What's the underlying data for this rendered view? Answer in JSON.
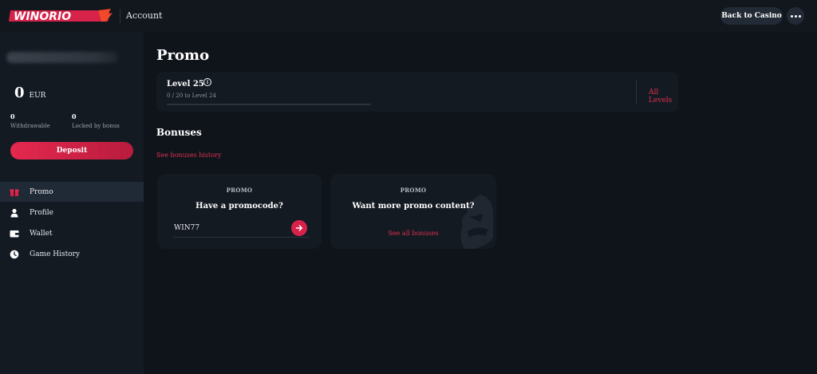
{
  "header": {
    "logo_text": "WINORIO",
    "title": "Account",
    "back_label": "Back to Casino",
    "more_icon": "more-dots-icon"
  },
  "sidebar": {
    "balance": {
      "amount": "0",
      "currency": "EUR"
    },
    "withdrawable": {
      "value": "0",
      "label": "Withdrawable"
    },
    "locked": {
      "value": "0",
      "label": "Locked by bonus"
    },
    "deposit_label": "Deposit",
    "items": [
      {
        "label": "Promo",
        "icon": "gift-icon",
        "active": true
      },
      {
        "label": "Profile",
        "icon": "user-icon",
        "active": false
      },
      {
        "label": "Wallet",
        "icon": "wallet-icon",
        "active": false
      },
      {
        "label": "Game History",
        "icon": "clock-icon",
        "active": false
      }
    ]
  },
  "main": {
    "title": "Promo",
    "level": {
      "title": "Level 25",
      "subtitle": "0 / 20 to Level 24",
      "progress": 0,
      "all_levels_label": "All Levels"
    },
    "bonuses": {
      "title": "Bonuses",
      "history_link": "See bonuses history"
    },
    "cards": [
      {
        "tag": "PROMO",
        "heading": "Have a promocode?",
        "input_value": "WIN77"
      },
      {
        "tag": "PROMO",
        "heading": "Want more promo content?",
        "link": "See all bonuses"
      }
    ]
  },
  "colors": {
    "accent": "#d7224a",
    "link": "#e03050",
    "background": "#0f141b",
    "panel": "#141a22"
  }
}
